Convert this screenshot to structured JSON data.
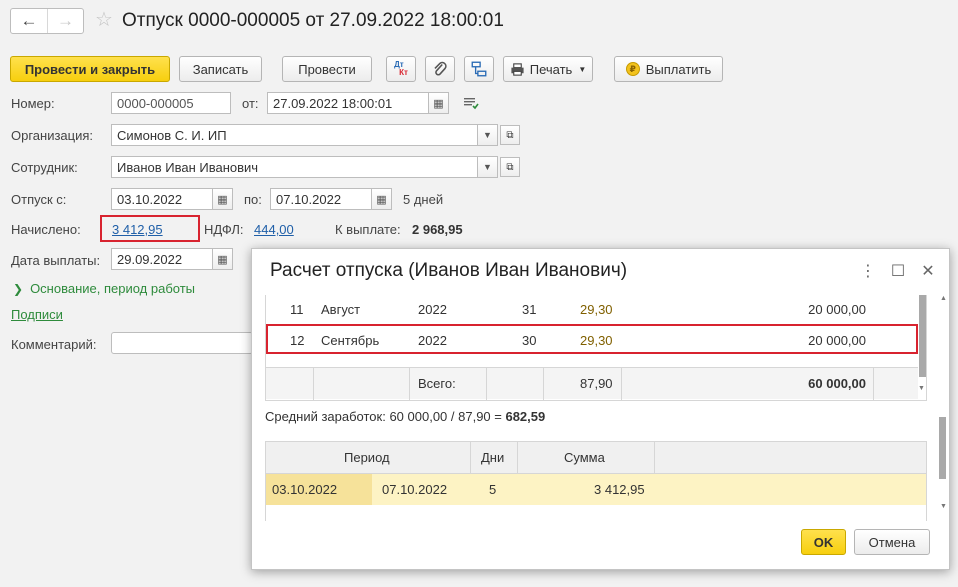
{
  "window": {
    "title": "Отпуск 0000-000005 от 27.09.2022 18:00:01",
    "icons": {
      "back": "arrow-left-icon",
      "forward": "arrow-right-icon",
      "favorite": "star-icon"
    }
  },
  "toolbar": {
    "post_close": "Провести и закрыть",
    "save": "Записать",
    "post": "Провести",
    "dt_kt_top": "Дт",
    "dt_kt_bottom": "Кт",
    "print": "Печать",
    "pay": "Выплатить"
  },
  "form": {
    "number_label": "Номер:",
    "number_value": "0000-000005",
    "date_label": "от:",
    "date_value": "27.09.2022 18:00:01",
    "org_label": "Организация:",
    "org_value": "Симонов С. И. ИП",
    "employee_label": "Сотрудник:",
    "employee_value": "Иванов Иван Иванович",
    "vac_from_label": "Отпуск с:",
    "vac_from_value": "03.10.2022",
    "vac_to_label": "по:",
    "vac_to_value": "07.10.2022",
    "days_text": "5 дней",
    "accrued_label": "Начислено:",
    "accrued_value": "3 412,95",
    "ndfl_label": "НДФЛ:",
    "ndfl_value": "444,00",
    "to_pay_label": "К выплате:",
    "to_pay_value": "2 968,95",
    "pay_date_label": "Дата выплаты:",
    "pay_date_value": "29.09.2022",
    "basis_link": "Основание, период работы",
    "signatures_link": "Подписи",
    "comment_label": "Комментарий:"
  },
  "dialog": {
    "title": "Расчет отпуска (Иванов Иван Иванович)",
    "earnings_rows": [
      {
        "num": "11",
        "month": "Август",
        "year": "2022",
        "days": "31",
        "coef": "29,30",
        "sum": "20 000,00"
      },
      {
        "num": "12",
        "month": "Сентябрь",
        "year": "2022",
        "days": "30",
        "coef": "29,30",
        "sum": "20 000,00"
      }
    ],
    "total_label": "Всего:",
    "total_coef": "87,90",
    "total_sum": "60 000,00",
    "avg_text": "Средний заработок: 60 000,00 / 87,90 = ",
    "avg_value": "682,59",
    "period_headers": {
      "period": "Период",
      "days": "Дни",
      "sum": "Сумма"
    },
    "period_row": {
      "from": "03.10.2022",
      "to": "07.10.2022",
      "days": "5",
      "sum": "3 412,95"
    },
    "ok": "OK",
    "cancel": "Отмена"
  }
}
